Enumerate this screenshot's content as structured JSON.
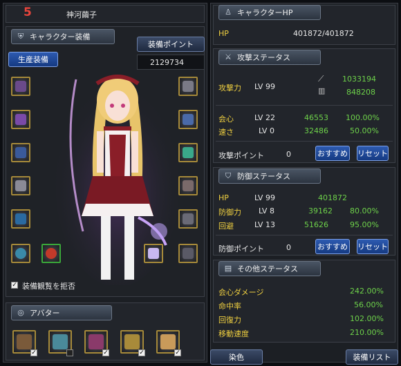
{
  "character": {
    "level_badge": "5",
    "name": "神河繭子"
  },
  "equip_section": {
    "tab_label": "キャラクター装備",
    "production_button": "生産装備",
    "points_label": "装備ポイント",
    "points_value": "2129734",
    "refuse_view_label": "装備観覧を拒否",
    "refuse_view_checked": true
  },
  "avatar_section": {
    "tab_label": "アバター"
  },
  "hp_section": {
    "tab_label": "キャラクターHP",
    "label": "HP",
    "value": "401872/401872"
  },
  "attack_section": {
    "tab_label": "攻撃ステータス",
    "attack_label": "攻撃力",
    "attack_level": "LV 99",
    "attack_values": [
      "1033194",
      "848208"
    ],
    "stats": [
      {
        "label": "会心",
        "level": "LV 22",
        "value": "46553",
        "percent": "100.00%"
      },
      {
        "label": "速さ",
        "level": "LV 0",
        "value": "32486",
        "percent": "50.00%"
      }
    ],
    "points_label": "攻撃ポイント",
    "points_value": "0",
    "recommend_button": "おすすめ",
    "reset_button": "リセット"
  },
  "defense_section": {
    "tab_label": "防御ステータス",
    "stats": [
      {
        "label": "HP",
        "level": "LV 99",
        "value": "401872",
        "percent": ""
      },
      {
        "label": "防御力",
        "level": "LV 8",
        "value": "39162",
        "percent": "80.00%"
      },
      {
        "label": "回避",
        "level": "LV 13",
        "value": "51626",
        "percent": "95.00%"
      }
    ],
    "points_label": "防御ポイント",
    "points_value": "0",
    "recommend_button": "おすすめ",
    "reset_button": "リセット"
  },
  "other_section": {
    "tab_label": "その他ステータス",
    "stats": [
      {
        "label": "会心ダメージ",
        "value": "242.00%"
      },
      {
        "label": "命中率",
        "value": "56.00%"
      },
      {
        "label": "回復力",
        "value": "102.00%"
      },
      {
        "label": "移動速度",
        "value": "210.00%"
      }
    ]
  },
  "footer": {
    "dye_button": "染色",
    "equip_list_button": "装備リスト"
  },
  "colors": {
    "label_yellow": "#f0d040",
    "value_green": "#6ed24a",
    "slot_border": "#a68a3a"
  },
  "icons": {
    "hp_tab": "character-icon",
    "attack_tab": "sword-icon",
    "defense_tab": "shield-icon",
    "other_tab": "book-icon",
    "equip_tab": "armor-icon",
    "avatar_tab": "mask-icon"
  }
}
